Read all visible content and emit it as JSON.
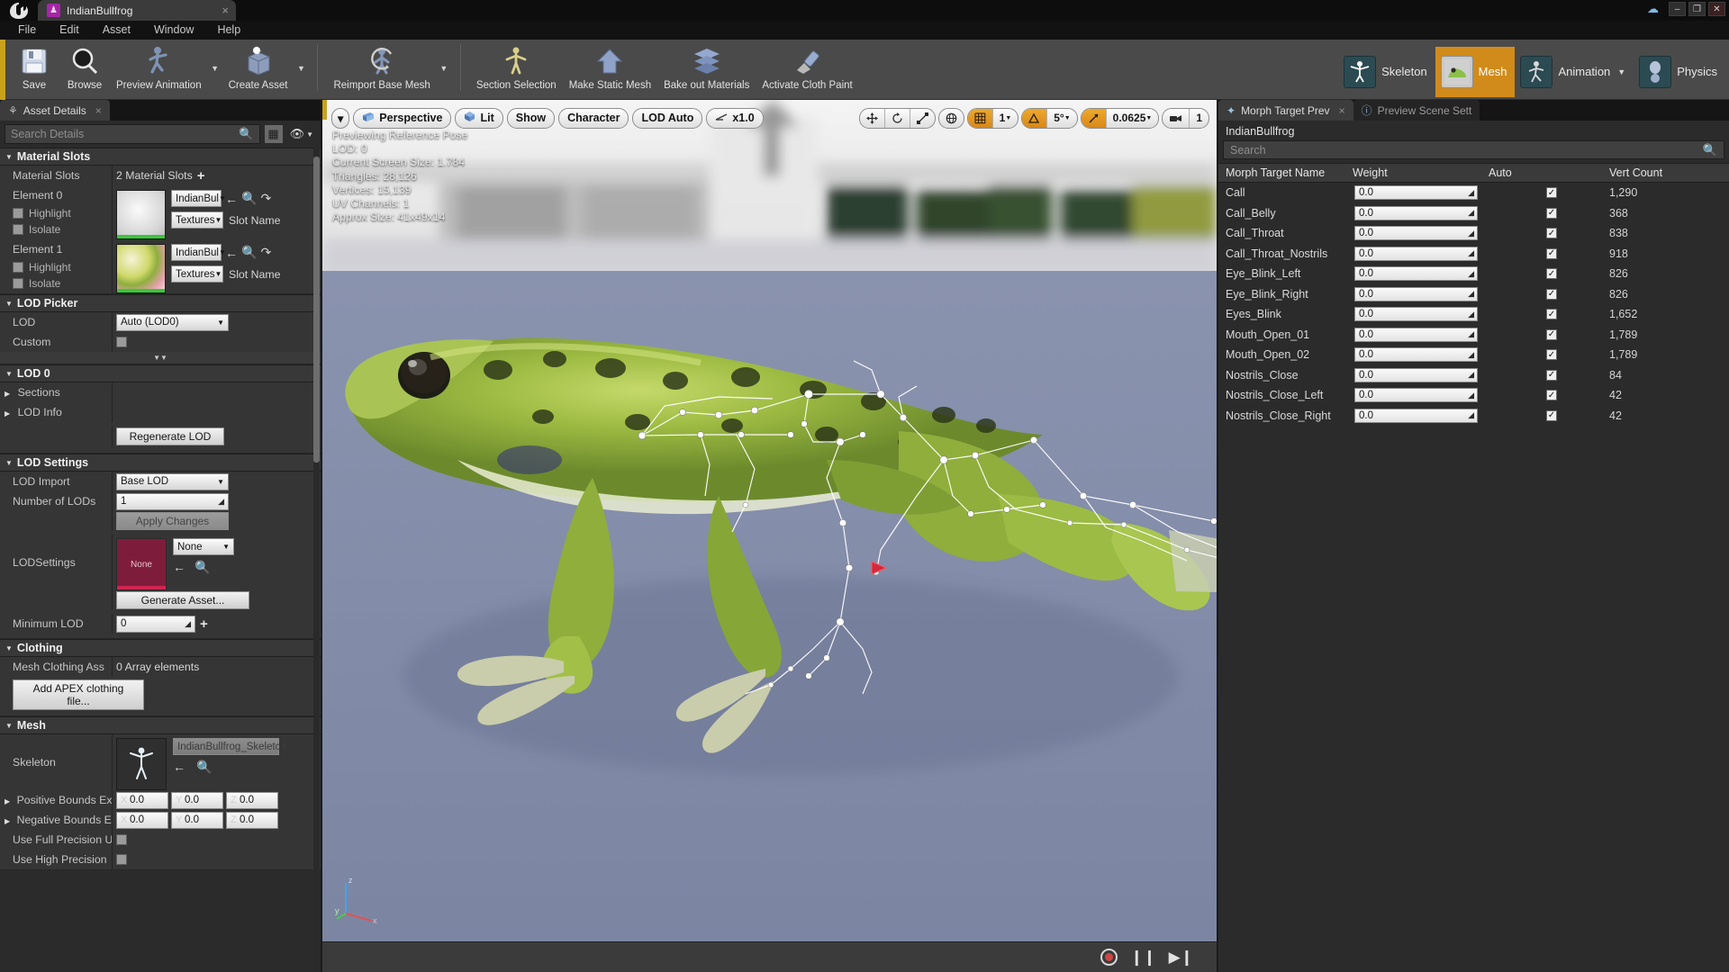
{
  "window": {
    "tab_title": "IndianBullfrog",
    "tab_icon": "mannequin-icon",
    "close_label": "×",
    "minimize_label": "–",
    "maximize_label": "❐",
    "win_close_label": "✕",
    "cloud_icon": "cloud-icon"
  },
  "menu": {
    "items": [
      "File",
      "Edit",
      "Asset",
      "Window",
      "Help"
    ]
  },
  "toolbar": {
    "groups": [
      {
        "buttons": [
          {
            "label": "Save",
            "icon": "save-disk-icon",
            "caret": false
          },
          {
            "label": "Browse",
            "icon": "magnifier-icon",
            "caret": false
          },
          {
            "label": "Preview Animation",
            "icon": "running-mannequin-icon",
            "caret": true
          },
          {
            "label": "Create Asset",
            "icon": "create-asset-icon",
            "caret": true
          }
        ]
      },
      {
        "buttons": [
          {
            "label": "Reimport Base Mesh",
            "icon": "reimport-icon",
            "caret": true
          }
        ]
      },
      {
        "buttons": [
          {
            "label": "Section Selection",
            "icon": "section-selection-icon",
            "caret": false
          },
          {
            "label": "Make Static Mesh",
            "icon": "static-mesh-icon",
            "caret": false
          },
          {
            "label": "Bake out Materials",
            "icon": "bake-materials-icon",
            "caret": false
          },
          {
            "label": "Activate Cloth Paint",
            "icon": "cloth-paint-icon",
            "caret": false
          }
        ]
      }
    ],
    "modes": [
      {
        "label": "Skeleton",
        "active": false,
        "icon": "skeleton-mode-icon",
        "caret": false
      },
      {
        "label": "Mesh",
        "active": true,
        "icon": "mesh-mode-icon",
        "caret": false
      },
      {
        "label": "Animation",
        "active": false,
        "icon": "animation-mode-icon",
        "caret": true
      },
      {
        "label": "Physics",
        "active": false,
        "icon": "physics-mode-icon",
        "caret": false
      }
    ]
  },
  "left_panel": {
    "tab_label": "Asset Details",
    "tab_icon": "asset-details-icon",
    "tab_close": "×",
    "search_placeholder": "Search Details",
    "search_icon": "search-icon",
    "grid_icon": "grid-view-icon",
    "eye_icon": "eye-icon",
    "caret_icon": "chevron-down-icon",
    "material_slots": {
      "header": "Material Slots",
      "row_label": "Material Slots",
      "count_text": "2 Material Slots",
      "add_label": "+",
      "elements": [
        {
          "label": "Element 0",
          "highlight": "Highlight",
          "isolate": "Isolate",
          "material": "IndianBul",
          "textures": "Textures",
          "slot_name": "Slot Name",
          "thumb": "white-sphere-thumb"
        },
        {
          "label": "Element 1",
          "highlight": "Highlight",
          "isolate": "Isolate",
          "material": "IndianBul",
          "textures": "Textures",
          "slot_name": "Slot Name",
          "thumb": "frog-skin-sphere-thumb"
        }
      ]
    },
    "lod_picker": {
      "header": "LOD Picker",
      "lod_label": "LOD",
      "lod_value": "Auto (LOD0)",
      "custom_label": "Custom"
    },
    "lod0": {
      "header": "LOD 0",
      "sections_label": "Sections",
      "lod_info_label": "LOD Info",
      "regenerate_label": "Regenerate LOD"
    },
    "lod_settings": {
      "header": "LOD Settings",
      "lod_import_label": "LOD Import",
      "lod_import_value": "Base LOD",
      "num_lods_label": "Number of LODs",
      "num_lods_value": "1",
      "apply_changes_label": "Apply Changes",
      "lodsettings_label": "LODSettings",
      "lodsettings_thumb_text": "None",
      "lodsettings_value": "None",
      "generate_asset_label": "Generate Asset...",
      "min_lod_label": "Minimum LOD",
      "min_lod_value": "0",
      "min_lod_plus": "+"
    },
    "clothing": {
      "header": "Clothing",
      "mesh_clothing_label": "Mesh Clothing Ass",
      "mesh_clothing_value": "0 Array elements",
      "add_apex_label": "Add APEX clothing file..."
    },
    "mesh": {
      "header": "Mesh",
      "skeleton_label": "Skeleton",
      "skeleton_value": "IndianBullfrog_Skeletc",
      "pos_bounds_label": "Positive Bounds Ex",
      "neg_bounds_label": "Negative Bounds E",
      "bounds_axes": [
        "X",
        "Y",
        "Z"
      ],
      "bounds_value": "0.0",
      "full_precision_label": "Use Full Precision U",
      "high_precision_label": "Use High Precision"
    }
  },
  "viewport": {
    "menu_caret": "▾",
    "buttons": [
      {
        "label": "Perspective",
        "icon": "camera-perspective-icon"
      },
      {
        "label": "Lit",
        "icon": "lit-cube-icon"
      },
      {
        "label": "Show",
        "icon": ""
      },
      {
        "label": "Character",
        "icon": ""
      },
      {
        "label": "LOD Auto",
        "icon": ""
      },
      {
        "label": "x1.0",
        "icon": "camera-speed-icon"
      }
    ],
    "transform_tools": [
      "select-icon",
      "rotate-icon",
      "scale-icon"
    ],
    "coord_toggle": "world-space-icon",
    "snap_grid": {
      "icon": "grid-snap-icon",
      "value": "1",
      "on": true
    },
    "snap_angle": {
      "icon": "angle-snap-icon",
      "value": "5°",
      "on": true
    },
    "snap_scale": {
      "icon": "scale-snap-icon",
      "value": "0.0625",
      "on": true
    },
    "camera_speed": {
      "icon": "camera-speed-icon",
      "value": "1",
      "on": false
    },
    "stats": [
      "Previewing Reference Pose",
      "LOD: 0",
      "Current Screen Size: 1.784",
      "Triangles: 28,126",
      "Vertices: 15,139",
      "UV Channels: 1",
      "Approx Size: 41x49x14"
    ],
    "axis_labels": {
      "x": "x",
      "y": "y",
      "z": "z"
    },
    "playback": {
      "record_label": "record-button",
      "pause_label": "pause-button",
      "step_label": "step-forward-button"
    }
  },
  "right_panel": {
    "tabs": [
      {
        "label": "Morph Target Prev",
        "icon": "morph-target-icon",
        "active": true,
        "close": "×"
      },
      {
        "label": "Preview Scene Sett",
        "icon": "preview-scene-icon",
        "active": false
      }
    ],
    "asset_name": "IndianBullfrog",
    "search_placeholder": "Search",
    "search_icon": "search-icon",
    "columns": [
      "Morph Target Name",
      "Weight",
      "Auto",
      "Vert Count"
    ],
    "rows": [
      {
        "name": "Call",
        "weight": "0.0",
        "auto": true,
        "vert": "1,290"
      },
      {
        "name": "Call_Belly",
        "weight": "0.0",
        "auto": true,
        "vert": "368"
      },
      {
        "name": "Call_Throat",
        "weight": "0.0",
        "auto": true,
        "vert": "838"
      },
      {
        "name": "Call_Throat_Nostrils",
        "weight": "0.0",
        "auto": true,
        "vert": "918"
      },
      {
        "name": "Eye_Blink_Left",
        "weight": "0.0",
        "auto": true,
        "vert": "826"
      },
      {
        "name": "Eye_Blink_Right",
        "weight": "0.0",
        "auto": true,
        "vert": "826"
      },
      {
        "name": "Eyes_Blink",
        "weight": "0.0",
        "auto": true,
        "vert": "1,652"
      },
      {
        "name": "Mouth_Open_01",
        "weight": "0.0",
        "auto": true,
        "vert": "1,789"
      },
      {
        "name": "Mouth_Open_02",
        "weight": "0.0",
        "auto": true,
        "vert": "1,789"
      },
      {
        "name": "Nostrils_Close",
        "weight": "0.0",
        "auto": true,
        "vert": "84"
      },
      {
        "name": "Nostrils_Close_Left",
        "weight": "0.0",
        "auto": true,
        "vert": "42"
      },
      {
        "name": "Nostrils_Close_Right",
        "weight": "0.0",
        "auto": true,
        "vert": "42"
      }
    ]
  },
  "colors": {
    "accent_orange": "#d18b1a",
    "toolbar_bg": "#4a4a4a",
    "panel_bg": "#2b2b2b",
    "category_bg": "#383838",
    "yellow_marker": "#c8a21c"
  }
}
